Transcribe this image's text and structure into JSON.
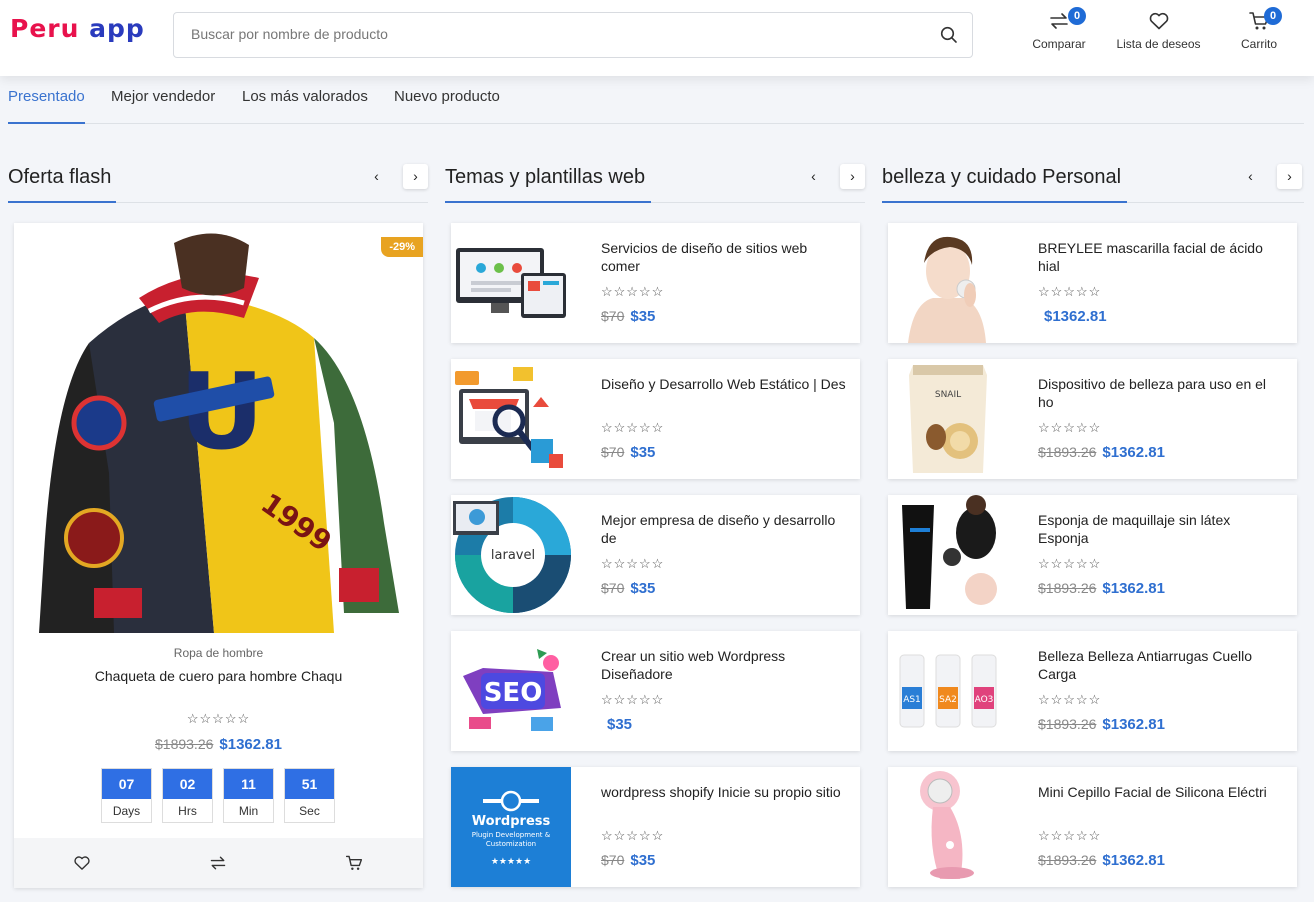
{
  "header": {
    "logo_part1": "Peru",
    "logo_part2": "app",
    "search_placeholder": "Buscar por nombre de producto",
    "compare_label": "Comparar",
    "compare_count": "0",
    "wishlist_label": "Lista de deseos",
    "cart_label": "Carrito",
    "cart_count": "0"
  },
  "tabs": [
    "Presentado",
    "Mejor vendedor",
    "Los más valorados",
    "Nuevo producto"
  ],
  "sections": {
    "flash": {
      "title": "Oferta flash",
      "prev": "‹",
      "next": "›"
    },
    "web": {
      "title": "Temas y plantillas web",
      "prev": "‹",
      "next": "›"
    },
    "beauty": {
      "title": "belleza y cuidado Personal",
      "prev": "‹",
      "next": "›"
    }
  },
  "flash_product": {
    "discount": "-29%",
    "category": "Ropa de hombre",
    "name": "Chaqueta de cuero para hombre Chaqu",
    "stars": "☆☆☆☆☆",
    "old_price": "$1893.26",
    "price": "$1362.81",
    "countdown": [
      {
        "value": "07",
        "label": "Days"
      },
      {
        "value": "02",
        "label": "Hrs"
      },
      {
        "value": "11",
        "label": "Min"
      },
      {
        "value": "51",
        "label": "Sec"
      }
    ]
  },
  "web_products": [
    {
      "title": "Servicios de diseño de sitios web comer",
      "stars": "☆☆☆☆☆",
      "old_price": "$70",
      "price": "$35"
    },
    {
      "title": "Diseño y Desarrollo Web Estático | Des",
      "stars": "☆☆☆☆☆",
      "old_price": "$70",
      "price": "$35"
    },
    {
      "title": "Mejor empresa de diseño y desarrollo de",
      "stars": "☆☆☆☆☆",
      "old_price": "$70",
      "price": "$35"
    },
    {
      "title": "Crear un sitio web Wordpress Diseñadore",
      "stars": "☆☆☆☆☆",
      "old_price": "",
      "price": "$35"
    },
    {
      "title": "wordpress shopify Inicie su propio sitio",
      "stars": "☆☆☆☆☆",
      "old_price": "$70",
      "price": "$35"
    }
  ],
  "beauty_products": [
    {
      "title": "BREYLEE mascarilla facial de ácido hial",
      "stars": "☆☆☆☆☆",
      "old_price": "",
      "price": "$1362.81"
    },
    {
      "title": "Dispositivo de belleza para uso en el ho",
      "stars": "☆☆☆☆☆",
      "old_price": "$1893.26",
      "price": "$1362.81"
    },
    {
      "title": "Esponja de maquillaje sin látex Esponja",
      "stars": "☆☆☆☆☆",
      "old_price": "$1893.26",
      "price": "$1362.81"
    },
    {
      "title": "Belleza Belleza Antiarrugas Cuello Carga",
      "stars": "☆☆☆☆☆",
      "old_price": "$1893.26",
      "price": "$1362.81"
    },
    {
      "title": "Mini Cepillo Facial de Silicona Eléctri",
      "stars": "☆☆☆☆☆",
      "old_price": "$1893.26",
      "price": "$1362.81"
    }
  ],
  "thumb_text": {
    "laravel": "laravel",
    "seo": "SEO",
    "wp_title": "Wordpress",
    "wp_sub1": "Plugin Development &",
    "wp_sub2": "Customization",
    "wp_stars": "★★★★★",
    "snail": "SNAIL",
    "as1": "AS1",
    "sa2": "SA2",
    "ao3": "AO3"
  },
  "colors": {
    "accent": "#3a73cf",
    "price": "#2f6fd0",
    "badge": "#1f6bd6",
    "discount": "#e8a321",
    "countdown": "#2f6fe4"
  }
}
